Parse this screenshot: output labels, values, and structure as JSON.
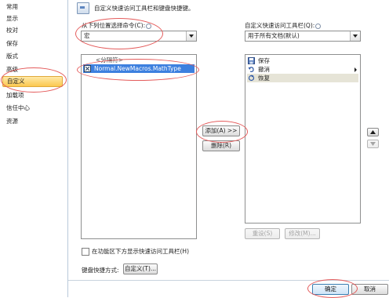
{
  "nav": {
    "items": [
      {
        "label": "常用"
      },
      {
        "label": "显示"
      },
      {
        "label": "校对"
      },
      {
        "label": "保存"
      },
      {
        "label": "版式"
      },
      {
        "label": "高级"
      },
      {
        "label": "自定义",
        "selected": true
      },
      {
        "label": "加载项"
      },
      {
        "label": "信任中心"
      },
      {
        "label": "资源"
      }
    ]
  },
  "header": {
    "text": "自定义快速访问工具栏和键盘快捷键。",
    "icon": "toolbar-icon"
  },
  "left_panel": {
    "label": "从下列位置选择命令(C):",
    "selected": "宏",
    "separator": "<分隔符>",
    "commands": [
      {
        "label": "Normal.NewMacros.MathType",
        "icon": "macro-icon",
        "selected": true
      }
    ]
  },
  "right_panel": {
    "label": "自定义快速访问工具栏(Q):",
    "selected": "用于所有文档(默认)",
    "items": [
      {
        "label": "保存",
        "icon": "save-icon"
      },
      {
        "label": "撤消",
        "icon": "undo-icon"
      },
      {
        "label": "恢复",
        "icon": "redo-icon",
        "selected": true
      }
    ],
    "reset_label": "重设(S)",
    "modify_label": "修改(M)..."
  },
  "middle": {
    "add_label": "添加(A) >>",
    "remove_label": "删除(R)"
  },
  "bottom": {
    "show_below_ribbon": "在功能区下方显示快速访问工具栏(H)",
    "keyboard_label": "键盘快捷方式:",
    "customize_label": "自定义(T)..."
  },
  "footer": {
    "ok_label": "确定",
    "cancel_label": "取消"
  },
  "colors": {
    "annotation": "#e45b5b",
    "selection": "#3d80df",
    "nav_selected": "#fbc84f"
  }
}
